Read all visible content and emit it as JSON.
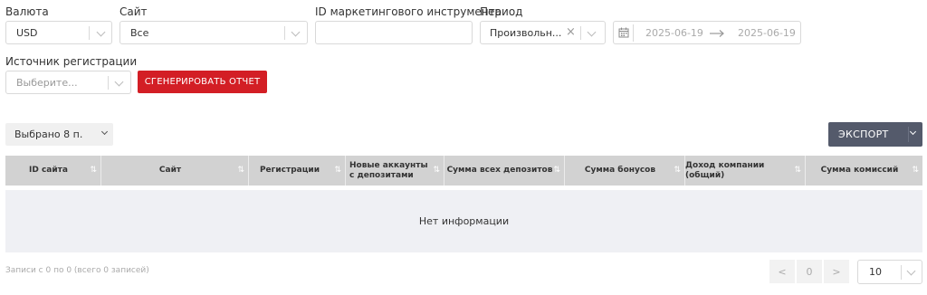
{
  "filters": {
    "currency": {
      "label": "Валюта",
      "value": "USD"
    },
    "site": {
      "label": "Сайт",
      "value": "Все"
    },
    "marketing_id": {
      "label": "ID маркетингового инструмента",
      "value": ""
    },
    "period": {
      "label": "Период",
      "value": "Произвольн...",
      "date_from": "2025-06-19",
      "date_to": "2025-06-19"
    },
    "reg_source": {
      "label": "Источник регистрации",
      "placeholder": "Выберите..."
    },
    "generate_label": "СГЕНЕРИРОВАТЬ ОТЧЕТ"
  },
  "toolbar": {
    "selected_label": "Выбрано 8 п.",
    "export_label": "ЭКСПОРТ"
  },
  "table": {
    "columns": [
      "ID сайта",
      "Сайт",
      "Регистрации",
      "Новые аккаунты с депозитами",
      "Сумма всех депозитов",
      "Сумма бонусов",
      "Доход компании (общий)",
      "Сумма комиссий"
    ],
    "empty_text": "Нет информации"
  },
  "footer": {
    "info": "Записи с 0 по 0 (всего 0 записей)",
    "prev": "<",
    "page": "0",
    "next": ">",
    "page_size": "10"
  },
  "colors": {
    "primary_button": "#d31e25",
    "export_button": "#545a6b",
    "table_header": "#d2d2d2",
    "table_body": "#eff0f4"
  }
}
